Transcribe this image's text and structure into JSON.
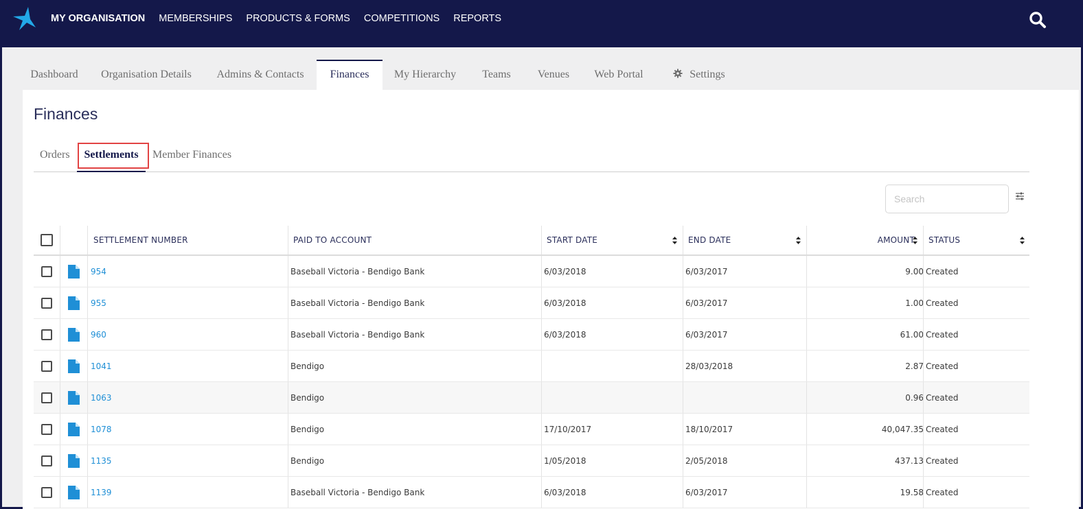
{
  "nav": {
    "logo": "star-logo",
    "items": [
      {
        "label": "MY ORGANISATION",
        "active": true
      },
      {
        "label": "MEMBERSHIPS"
      },
      {
        "label": "PRODUCTS & FORMS"
      },
      {
        "label": "COMPETITIONS"
      },
      {
        "label": "REPORTS"
      }
    ],
    "search_icon": "search-icon"
  },
  "tabs": [
    {
      "label": "Dashboard"
    },
    {
      "label": "Organisation Details"
    },
    {
      "label": "Admins & Contacts"
    },
    {
      "label": "Finances",
      "active": true
    },
    {
      "label": "My Hierarchy"
    },
    {
      "label": "Teams"
    },
    {
      "label": "Venues"
    },
    {
      "label": "Web Portal"
    },
    {
      "label": "Settings",
      "icon": "gear-icon"
    }
  ],
  "page": {
    "title": "Finances",
    "subtabs": [
      {
        "label": "Orders"
      },
      {
        "label": "Settlements",
        "active": true
      },
      {
        "label": "Member Finances"
      }
    ],
    "search_placeholder": "Search"
  },
  "table": {
    "headers": {
      "number": "SETTLEMENT NUMBER",
      "account": "PAID TO ACCOUNT",
      "start": "START DATE",
      "end": "END DATE",
      "amount": "AMOUNT",
      "status": "STATUS"
    },
    "rows": [
      {
        "number": "954",
        "account": "Baseball Victoria - Bendigo Bank",
        "start": "6/03/2018",
        "end": "6/03/2017",
        "amount": "9.00",
        "status": "Created"
      },
      {
        "number": "955",
        "account": "Baseball Victoria - Bendigo Bank",
        "start": "6/03/2018",
        "end": "6/03/2017",
        "amount": "1.00",
        "status": "Created"
      },
      {
        "number": "960",
        "account": "Baseball Victoria - Bendigo Bank",
        "start": "6/03/2018",
        "end": "6/03/2017",
        "amount": "61.00",
        "status": "Created"
      },
      {
        "number": "1041",
        "account": "Bendigo",
        "start": "",
        "end": "28/03/2018",
        "amount": "2.87",
        "status": "Created"
      },
      {
        "number": "1063",
        "account": "Bendigo",
        "start": "",
        "end": "",
        "amount": "0.96",
        "status": "Created"
      },
      {
        "number": "1078",
        "account": "Bendigo",
        "start": "17/10/2017",
        "end": "18/10/2017",
        "amount": "40,047.35",
        "status": "Created"
      },
      {
        "number": "1135",
        "account": "Bendigo",
        "start": "1/05/2018",
        "end": "2/05/2018",
        "amount": "437.13",
        "status": "Created"
      },
      {
        "number": "1139",
        "account": "Baseball Victoria - Bendigo Bank",
        "start": "6/03/2018",
        "end": "6/03/2017",
        "amount": "19.58",
        "status": "Created"
      }
    ]
  },
  "colors": {
    "navy": "#14184a",
    "link": "#1f8fd6",
    "highlight": "#e24343"
  }
}
